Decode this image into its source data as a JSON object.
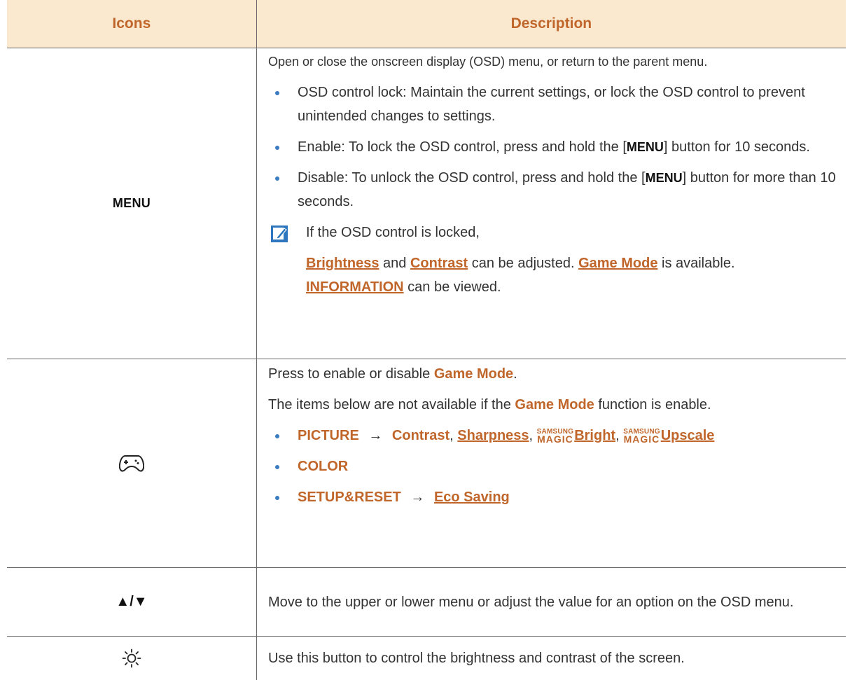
{
  "header": {
    "icons": "Icons",
    "description": "Description"
  },
  "row1": {
    "icon_label": "MENU",
    "intro": "Open or close the onscreen display (OSD) menu, or return to the parent menu.",
    "bullets": [
      "OSD control lock: Maintain the current settings, or lock the OSD control to prevent unintended changes to settings.",
      "Enable: To lock the OSD control, press and hold the [",
      "] button for 10 seconds.",
      "Disable: To unlock the OSD control, press and hold the [",
      "] button for more than 10 seconds."
    ],
    "menu_word": "MENU",
    "note": {
      "line1": "If the OSD control is locked,",
      "brightness": "Brightness",
      "and": " and ",
      "contrast": "Contrast",
      "can_adjusted": " can be adjusted. ",
      "game_mode": "Game Mode",
      "is_available": " is available.",
      "information": "INFORMATION",
      "can_viewed": " can be viewed."
    }
  },
  "row2": {
    "icon": "gamepad-icon",
    "line1_pre": "Press to enable or disable ",
    "line1_em": "Game Mode",
    "line1_post": ".",
    "line2_pre": "The items below are not available if the ",
    "line2_em": "Game Mode",
    "line2_post": " function is enable.",
    "picture": "PICTURE",
    "arrow": "→",
    "contrast": "Contrast",
    "comma": ",",
    "sharpness": "Sharpness",
    "samsung": "SAMSUNG",
    "magic": "MAGIC",
    "bright": "Bright",
    "upscale": "Upscale",
    "color": "COLOR",
    "setup": "SETUP&RESET",
    "eco": "Eco Saving"
  },
  "row3": {
    "icon_label": "▲/▼",
    "text": "Move to the upper or lower menu or adjust the value for an option on the OSD menu."
  },
  "row4": {
    "icon": "brightness-icon",
    "text": "Use this button to control the brightness and contrast of the screen."
  },
  "colors": {
    "accent": "#c0662b",
    "header_bg": "#fbe9cf",
    "bullet": "#3b7cc0"
  }
}
